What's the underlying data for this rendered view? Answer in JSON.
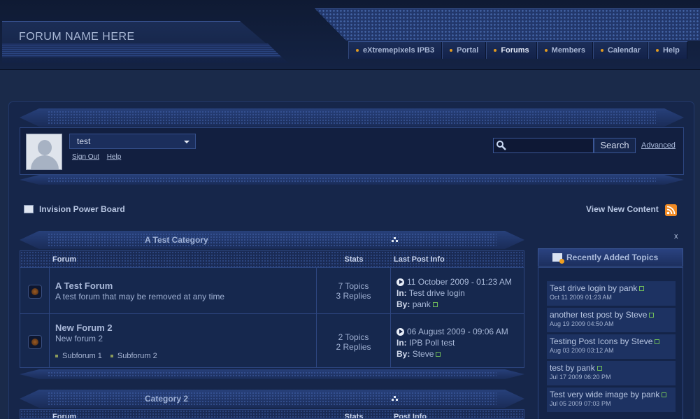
{
  "header": {
    "forum_name": "FORUM NAME HERE",
    "nav": [
      {
        "label": "eXtremepixels IPB3"
      },
      {
        "label": "Portal"
      },
      {
        "label": "Forums"
      },
      {
        "label": "Members"
      },
      {
        "label": "Calendar"
      },
      {
        "label": "Help"
      }
    ]
  },
  "user": {
    "name": "test",
    "sign_out": "Sign Out",
    "help": "Help"
  },
  "search": {
    "placeholder": "",
    "button": "Search",
    "advanced": "Advanced"
  },
  "breadcrumb": {
    "home": "Invision Power Board"
  },
  "view_new": "View New Content",
  "close": "x",
  "categories": [
    {
      "name": "A Test Category",
      "columns": {
        "forum": "Forum",
        "stats": "Stats",
        "last": "Last Post Info"
      },
      "forums": [
        {
          "title": "A Test Forum",
          "desc": "A test forum that may be removed at any time",
          "topics": "7 Topics",
          "replies": "3 Replies",
          "last_date": "11 October 2009 - 01:23 AM",
          "in_label": "In:",
          "in_topic": "Test drive login",
          "by_label": "By:",
          "by_user": "pank"
        },
        {
          "title": "New Forum 2",
          "desc": "New forum 2",
          "subforums": [
            "Subforum 1",
            "Subforum 2"
          ],
          "topics": "2 Topics",
          "replies": "2 Replies",
          "last_date": "06 August 2009 - 09:06 AM",
          "in_label": "In:",
          "in_topic": "IPB Poll test",
          "by_label": "By:",
          "by_user": "Steve"
        }
      ]
    },
    {
      "name": "Category 2",
      "columns": {
        "forum": "Forum",
        "stats": "Stats",
        "last": "Post Info"
      }
    }
  ],
  "sidebar": {
    "title": "Recently Added Topics",
    "items": [
      {
        "title": "Test drive login by pank",
        "date": "Oct 11 2009 01:23 AM"
      },
      {
        "title": "another test post by Steve",
        "date": "Aug 19 2009 04:50 AM"
      },
      {
        "title": "Testing Post Icons by Steve",
        "date": "Aug 03 2009 03:12 AM"
      },
      {
        "title": "test by pank",
        "date": "Jul 17 2009 06:20 PM"
      },
      {
        "title": "Test very wide image by pank",
        "date": "Jul 05 2009 07:03 PM"
      }
    ]
  }
}
